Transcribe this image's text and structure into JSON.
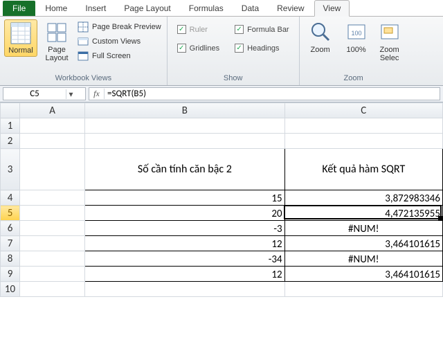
{
  "tabs": {
    "file": "File",
    "items": [
      "Home",
      "Insert",
      "Page Layout",
      "Formulas",
      "Data",
      "Review",
      "View"
    ],
    "active": "View"
  },
  "ribbon": {
    "workbook_views": {
      "label": "Workbook Views",
      "normal": "Normal",
      "page_layout": "Page\nLayout",
      "page_break": "Page Break Preview",
      "custom_views": "Custom Views",
      "full_screen": "Full Screen"
    },
    "show": {
      "label": "Show",
      "ruler": "Ruler",
      "gridlines": "Gridlines",
      "formula_bar": "Formula Bar",
      "headings": "Headings"
    },
    "zoom": {
      "label": "Zoom",
      "zoom": "Zoom",
      "hundred": "100%",
      "to_selection": "Zoom\nSelec"
    }
  },
  "formula_bar": {
    "cell_ref": "C5",
    "fx": "fx",
    "formula": "=SQRT(B5)"
  },
  "columns": [
    "A",
    "B",
    "C"
  ],
  "rows": [
    "1",
    "2",
    "3",
    "4",
    "5",
    "6",
    "7",
    "8",
    "9",
    "10"
  ],
  "active_col": "C",
  "active_row": "5",
  "data_headers": {
    "b": "Số cần tính căn bậc 2",
    "c": "Kết quả hàm SQRT"
  },
  "rows_data": [
    {
      "b": "15",
      "c": "3,872983346"
    },
    {
      "b": "20",
      "c": "4,472135955"
    },
    {
      "b": "-3",
      "c": "#NUM!"
    },
    {
      "b": "12",
      "c": "3,464101615"
    },
    {
      "b": "-34",
      "c": "#NUM!"
    },
    {
      "b": "12",
      "c": "3,464101615"
    }
  ]
}
